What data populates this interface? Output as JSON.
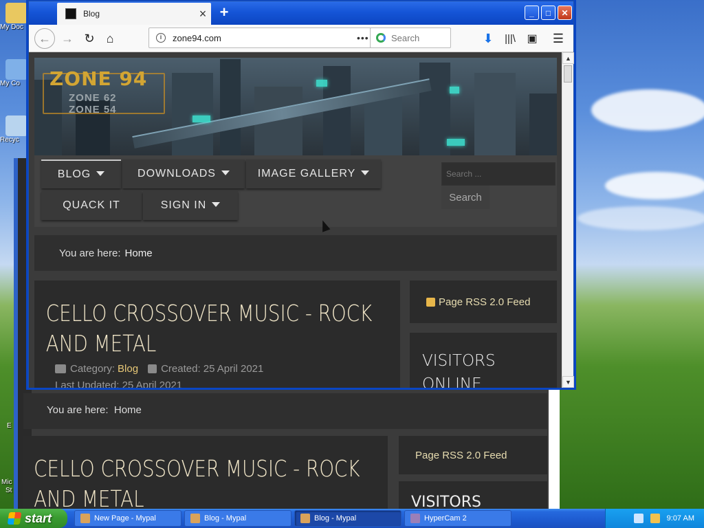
{
  "desktop": {
    "icons": [
      {
        "label": "My Doc"
      },
      {
        "label": "My Co"
      },
      {
        "label": "Recyc"
      }
    ],
    "side_labels": [
      "E",
      "Mic",
      "St"
    ]
  },
  "background_window": {
    "breadcrumb_prefix": "You are here:",
    "breadcrumb_home": "Home",
    "article_title": "CELLO CROSSOVER MUSIC - ROCK AND METAL",
    "rss_label": "Page RSS 2.0 Feed",
    "visitors_title": "VISITORS"
  },
  "browser": {
    "tab_title": "Blog",
    "new_tab_label": "+",
    "window_controls": {
      "minimize": "_",
      "maximize": "□",
      "close": "✕"
    },
    "url": "zone94.com",
    "page_actions": "•••",
    "search_placeholder": "Search",
    "site": {
      "logo_main": "ZONE 94",
      "logo_sub1": "ZONE 62",
      "logo_sub2": "ZONE 54",
      "nav": [
        {
          "label": "BLOG",
          "dropdown": true
        },
        {
          "label": "DOWNLOADS",
          "dropdown": true
        },
        {
          "label": "IMAGE GALLERY",
          "dropdown": true
        },
        {
          "label": "QUACK IT",
          "dropdown": false
        },
        {
          "label": "SIGN IN",
          "dropdown": true
        }
      ],
      "search_placeholder": "Search ...",
      "search_button": "Search",
      "breadcrumb_prefix": "You are here:",
      "breadcrumb_home": "Home",
      "article": {
        "title": "CELLO CROSSOVER MUSIC - ROCK AND METAL",
        "category_label": "Category:",
        "category_value": "Blog",
        "created": "Created: 25 April 2021",
        "updated": "Last Updated: 25 April 2021"
      },
      "rss_label": "Page RSS 2.0 Feed",
      "visitors_title": "VISITORS ONLINE"
    }
  },
  "taskbar": {
    "start_label": "start",
    "tasks": [
      {
        "label": "New Page - Mypal",
        "active": false
      },
      {
        "label": "Blog - Mypal",
        "active": false
      },
      {
        "label": "Blog - Mypal",
        "active": true
      },
      {
        "label": "HyperCam 2",
        "active": false
      }
    ],
    "clock": "9:07 AM"
  },
  "colors": {
    "xp_blue": "#0c45c1",
    "page_bg": "#3b3b3b",
    "accent_gold": "#e8c877",
    "title_cream": "#f1e6c8"
  }
}
